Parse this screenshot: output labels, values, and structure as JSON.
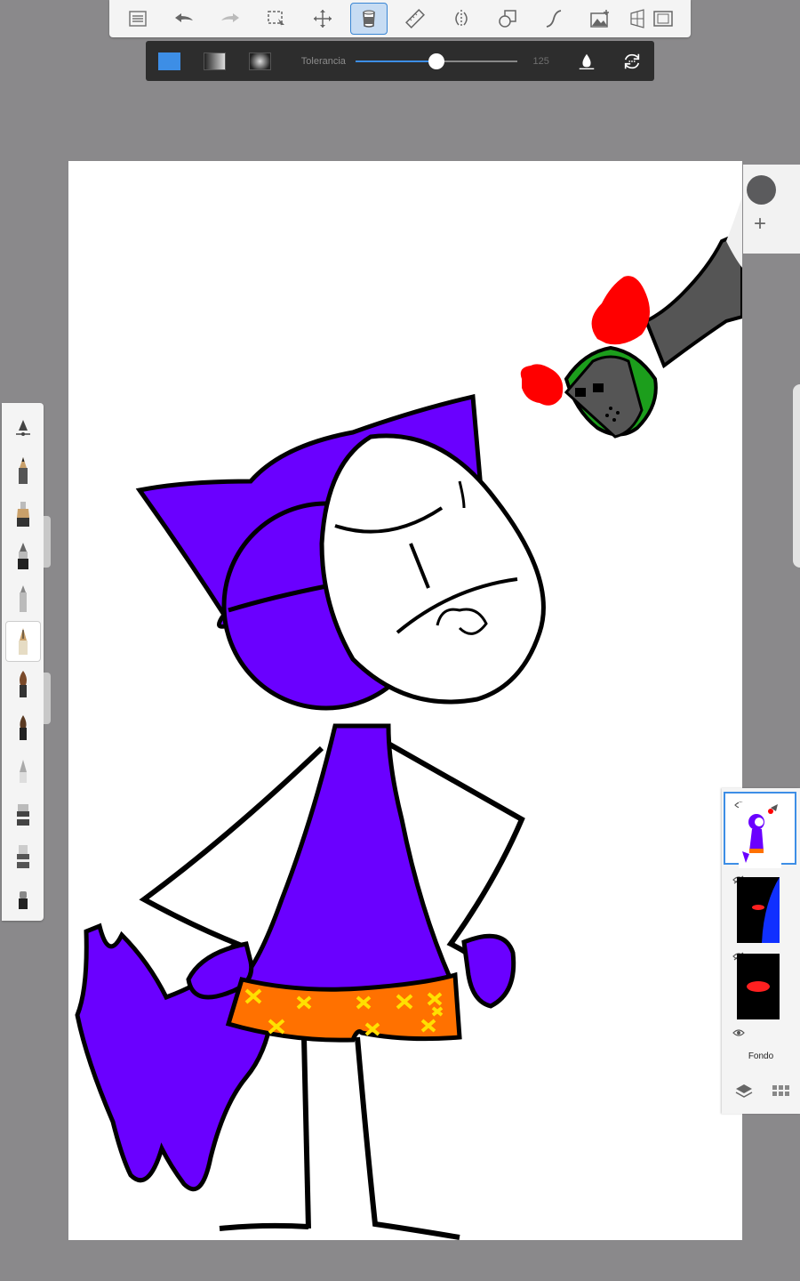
{
  "fill_toolbar": {
    "tolerance_label": "Tolerancia",
    "tolerance_value": "125",
    "tolerance_fraction": 0.5,
    "accent_color": "#3d8ee6"
  },
  "toolbar": {
    "icons": [
      "list-icon",
      "undo-icon",
      "redo-icon",
      "selection-icon",
      "transform-icon",
      "fill-icon",
      "ruler-icon",
      "symmetry-icon",
      "shape-icon",
      "curve-icon",
      "add-image-icon",
      "perspective-icon",
      "fullscreen-icon"
    ],
    "active_tool": "fill-icon"
  },
  "color_panel": {
    "current_color": "#5b5b5d"
  },
  "layers": {
    "items": [
      {
        "name": "",
        "selected": true
      },
      {
        "name": "",
        "selected": false
      },
      {
        "name": "",
        "selected": false
      },
      {
        "name": "Fondo",
        "selected": false
      }
    ]
  }
}
